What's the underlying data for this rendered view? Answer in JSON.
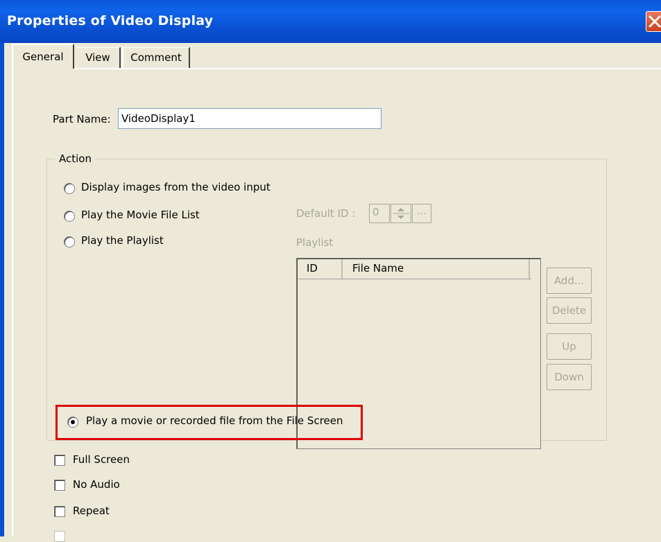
{
  "window": {
    "title": "Properties of Video Display",
    "close_icon": "close-icon"
  },
  "tabs": [
    "General",
    "View",
    "Comment"
  ],
  "part_name": {
    "label": "Part Name:",
    "value": "VideoDisplay1"
  },
  "action": {
    "group_label": "Action",
    "options": [
      {
        "label": "Display images from the video input",
        "checked": false
      },
      {
        "label": "Play the Movie File List",
        "checked": false
      },
      {
        "label": "Play the Playlist",
        "checked": false
      },
      {
        "label": "Play a movie or recorded file from the File Screen",
        "checked": true
      }
    ],
    "default_id_label": "Default ID  :",
    "default_id_value": "0",
    "browse_label": "...",
    "playlist_label": "Playlist",
    "playlist_columns": [
      "ID",
      "File Name"
    ],
    "buttons": [
      "Add...",
      "Delete",
      "Up",
      "Down"
    ]
  },
  "checkboxes": [
    {
      "label": "Full Screen",
      "checked": false
    },
    {
      "label": "No Audio",
      "checked": false
    },
    {
      "label": "Repeat",
      "checked": false
    }
  ],
  "colors": {
    "title_bar": "#0a55d8",
    "highlight": "#e00000",
    "dialog_bg": "#ece9d8"
  }
}
